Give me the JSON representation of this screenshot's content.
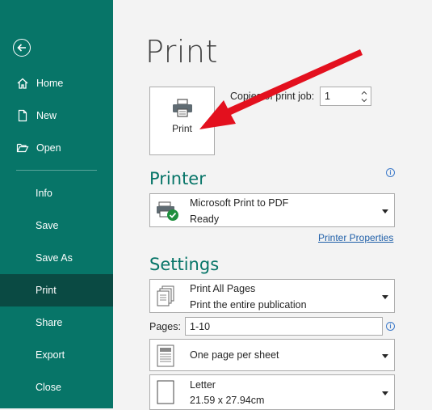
{
  "sidebar": {
    "back_label": "Back",
    "items": [
      {
        "label": "Home",
        "icon": "home-icon"
      },
      {
        "label": "New",
        "icon": "new-document-icon"
      },
      {
        "label": "Open",
        "icon": "folder-open-icon"
      },
      {
        "label": "Info"
      },
      {
        "label": "Save"
      },
      {
        "label": "Save As"
      },
      {
        "label": "Print",
        "active": true
      },
      {
        "label": "Share"
      },
      {
        "label": "Export"
      },
      {
        "label": "Close"
      }
    ]
  },
  "main": {
    "title": "Print",
    "print_button_label": "Print",
    "copies_label": "Copies of print job:",
    "copies_value": "1",
    "printer_section": "Printer",
    "printer": {
      "name": "Microsoft Print to PDF",
      "status": "Ready"
    },
    "printer_properties_link": "Printer Properties",
    "settings_section": "Settings",
    "print_range": {
      "title": "Print All Pages",
      "subtitle": "Print the entire publication"
    },
    "pages_label": "Pages:",
    "pages_value": "1-10",
    "layout": {
      "title": "One page per sheet"
    },
    "paper": {
      "title": "Letter",
      "subtitle": "21.59 x 27.94cm"
    }
  },
  "colors": {
    "sidebar": "#077568",
    "sidebar_active": "#0a4a43",
    "accent": "#077568",
    "arrow": "#e3101e",
    "link": "#1f5fa8"
  }
}
